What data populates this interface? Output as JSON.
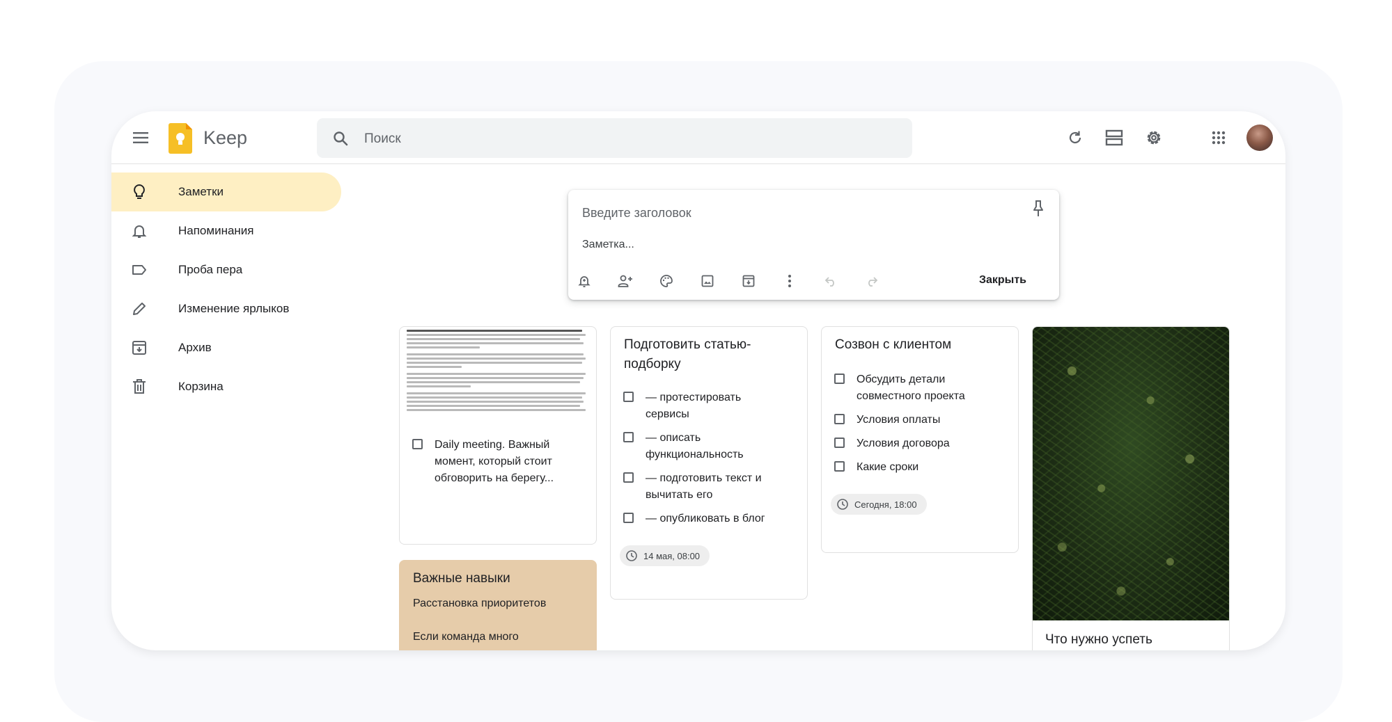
{
  "app": {
    "name": "Keep"
  },
  "search": {
    "placeholder": "Поиск"
  },
  "sidebar": {
    "items": [
      {
        "label": "Заметки",
        "icon": "lightbulb-icon",
        "active": true
      },
      {
        "label": "Напоминания",
        "icon": "bell-icon"
      },
      {
        "label": "Проба пера",
        "icon": "label-icon"
      },
      {
        "label": "Изменение ярлыков",
        "icon": "pencil-icon"
      },
      {
        "label": "Архив",
        "icon": "archive-icon"
      },
      {
        "label": "Корзина",
        "icon": "trash-icon"
      }
    ]
  },
  "composer": {
    "title_placeholder": "Введите заголовок",
    "body_placeholder": "Заметка...",
    "close_label": "Закрыть"
  },
  "notes": {
    "daily": {
      "items": [
        "Daily meeting. Важный момент, который стоит обговорить на берегу..."
      ]
    },
    "skills": {
      "title": "Важные навыки",
      "line1": "Расстановка приоритетов",
      "line2": "Если команда много",
      "bg_color": "#e6ccaa"
    },
    "article": {
      "title": "Подготовить статью-подборку",
      "items": [
        "— протестировать сервисы",
        "— описать функциональность",
        "— подготовить текст и вычитать его",
        "— опубликовать в блог"
      ],
      "reminder": "14 мая, 08:00"
    },
    "call": {
      "title": "Созвон с клиентом",
      "items": [
        "Обсудить детали совместного проекта",
        "Условия оплаты",
        "Условия договора",
        "Какие сроки"
      ],
      "reminder": "Сегодня, 18:00"
    },
    "photo": {
      "title": "Что нужно успеть"
    }
  },
  "colors": {
    "accent_active_nav": "#feefc3",
    "logo_yellow": "#f6bf26"
  }
}
